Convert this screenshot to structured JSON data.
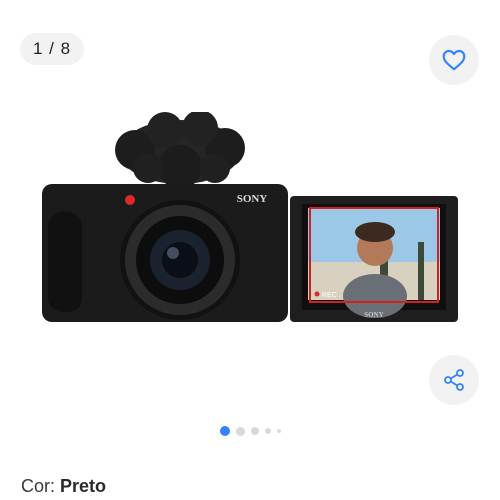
{
  "gallery": {
    "counter": "1 / 8",
    "total_images": 8,
    "current_image": 1,
    "active_color": "#3483fa",
    "inactive_color": "#d9d9d9"
  },
  "product_image": {
    "brand_text": "SONY",
    "screen_brand_text": "SONY",
    "rec_label": "REC"
  },
  "actions": {
    "favorite_icon": "heart-icon",
    "share_icon": "share-icon"
  },
  "attribute": {
    "label": "Cor:",
    "value": "Preto"
  }
}
